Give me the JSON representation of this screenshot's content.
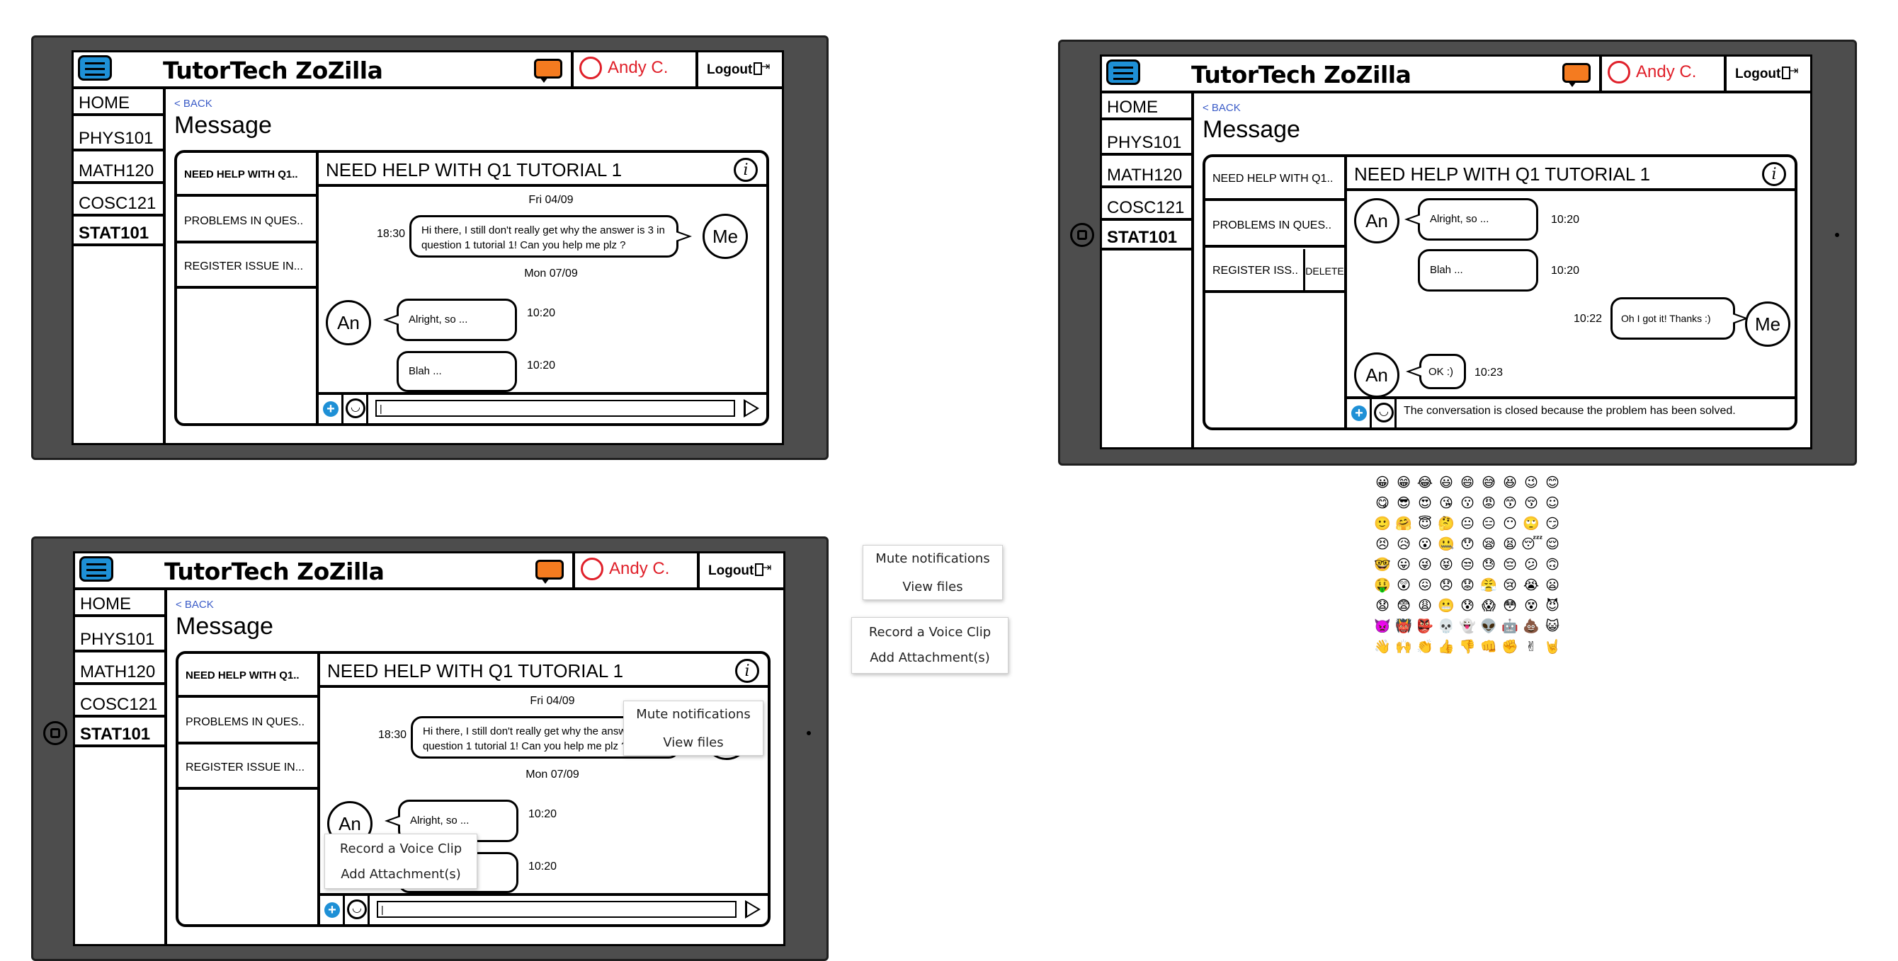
{
  "app": {
    "title": "TutorTech ZoZilla",
    "user": "Andy C.",
    "logout": "Logout",
    "back": "< BACK",
    "page_title": "Message"
  },
  "sidebar": {
    "items": [
      "HOME",
      "PHYS101",
      "MATH120",
      "COSC121",
      "STAT101"
    ]
  },
  "conversations": {
    "left": [
      "NEED HELP WITH Q1..",
      "PROBLEMS IN QUES..",
      "REGISTER ISSUE IN..."
    ],
    "right": [
      "NEED HELP WITH Q1..",
      "PROBLEMS IN QUES..",
      "REGISTER ISS.."
    ],
    "delete": "DELETE"
  },
  "chat": {
    "title": "NEED HELP WITH Q1 TUTORIAL 1",
    "info_icon": "i",
    "avatar_me": "Me",
    "avatar_an": "An",
    "date1": "Fri 04/09",
    "date2": "Mon 07/09",
    "msg_me_time": "18:30",
    "msg_me_text": "Hi there, I still don't really get why the answer is 3 in question 1 tutorial 1! Can you help me plz ?",
    "msg_an1_text": "Alright, so ...",
    "msg_an1_time": "10:20",
    "msg_an2_text": "Blah ...",
    "msg_an2_time": "10:20",
    "msg_me2_time": "10:22",
    "msg_me2_text": "Oh I got it! Thanks :)",
    "msg_an3_text": "OK :)",
    "msg_an3_time": "10:23",
    "input_value": "|",
    "closed_notice": "The conversation is closed because the problem has been solved."
  },
  "menus": {
    "info_menu": [
      "Mute notifications",
      "View files"
    ],
    "attach_menu": [
      "Record a Voice Clip",
      "Add Attachment(s)"
    ]
  },
  "emojis": [
    "😀",
    "😁",
    "😂",
    "😃",
    "😄",
    "😅",
    "😆",
    "😉",
    "😊",
    "😋",
    "😎",
    "😍",
    "😘",
    "😗",
    "😡",
    "😙",
    "😚",
    "☺",
    "🙂",
    "🤗",
    "😇",
    "🤔",
    "😐",
    "😑",
    "😶",
    "🙄",
    "😏",
    "😣",
    "😥",
    "😮",
    "🤐",
    "😯",
    "😪",
    "😫",
    "😴",
    "😌",
    "🤓",
    "😛",
    "😜",
    "😝",
    "😒",
    "😓",
    "😔",
    "😕",
    "🙃",
    "🤑",
    "😲",
    "😖",
    "😞",
    "😟",
    "😤",
    "😢",
    "😭",
    "😦",
    "😧",
    "😨",
    "😩",
    "😬",
    "😰",
    "😱",
    "😳",
    "😵",
    "😈",
    "👿",
    "👹",
    "👺",
    "💀",
    "👻",
    "👽",
    "🤖",
    "💩",
    "😺",
    "👋",
    "🙌",
    "👏",
    "👍",
    "👎",
    "👊",
    "✊",
    "✌",
    "🤘"
  ],
  "colors": {
    "tablet": "#4d4d4d",
    "menu_icon": "#1e90d6",
    "chat_icon": "#f47b20",
    "user_accent": "#e0202a",
    "back_link": "#3a5bc7"
  }
}
